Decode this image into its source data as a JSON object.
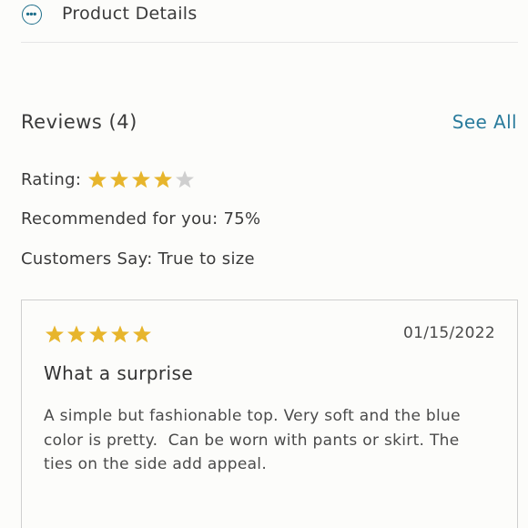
{
  "product": {
    "label": "Product Details",
    "icon": "more-dots-icon"
  },
  "reviews": {
    "title": "Reviews (4)",
    "see_all": "See All",
    "rating_label": "Rating:",
    "rating_value": 4,
    "rating_max": 5,
    "recommended": "Recommended for you: 75%",
    "customers_say": "Customers Say: True to size"
  },
  "review": {
    "rating": 5,
    "date": "01/15/2022",
    "title": "What a surprise",
    "body": "A simple but fashionable top. Very soft and the blue color is pretty.  Can be worn with pants or skirt. The ties on the side add appeal."
  },
  "colors": {
    "accent": "#2a7b9c",
    "star_filled": "#e7b52c",
    "star_empty": "#cfcfcf"
  }
}
